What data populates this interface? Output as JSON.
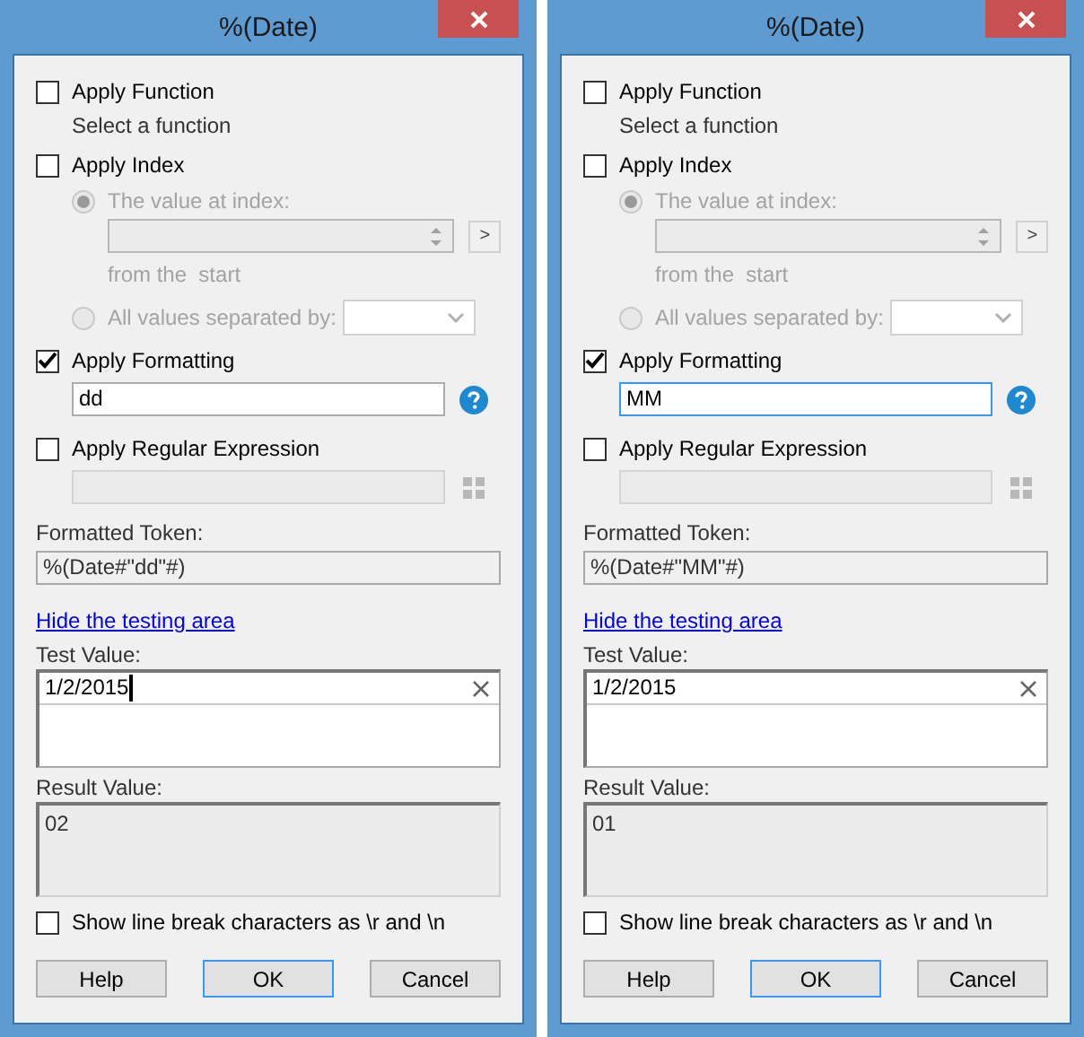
{
  "dialogs": [
    {
      "title": "%(Date)",
      "apply_function": {
        "label": "Apply Function",
        "checked": false,
        "hint": "Select a function"
      },
      "apply_index": {
        "label": "Apply Index",
        "checked": false,
        "options": [
          {
            "label": "The value at index:",
            "selected": true
          },
          {
            "label": "All values separated by:",
            "selected": false
          }
        ],
        "from_label": "from the  start",
        "next_button": ">"
      },
      "apply_formatting": {
        "label": "Apply Formatting",
        "checked": true,
        "value": "dd",
        "focused": false
      },
      "apply_regex": {
        "label": "Apply Regular Expression",
        "checked": false
      },
      "formatted_token": {
        "label": "Formatted Token:",
        "value": "%(Date#\"dd\"#)"
      },
      "link": "Hide the testing area",
      "test_value": {
        "label": "Test Value:",
        "value": "1/2/2015",
        "focused": true
      },
      "result_value": {
        "label": "Result Value:",
        "value": "02"
      },
      "show_line_breaks": {
        "label": "Show line break characters as \\r and \\n",
        "checked": false
      },
      "buttons": [
        {
          "label": "Help",
          "default": false
        },
        {
          "label": "OK",
          "default": true
        },
        {
          "label": "Cancel",
          "default": false
        }
      ]
    },
    {
      "title": "%(Date)",
      "apply_function": {
        "label": "Apply Function",
        "checked": false,
        "hint": "Select a function"
      },
      "apply_index": {
        "label": "Apply Index",
        "checked": false,
        "options": [
          {
            "label": "The value at index:",
            "selected": true
          },
          {
            "label": "All values separated by:",
            "selected": false
          }
        ],
        "from_label": "from the  start",
        "next_button": ">"
      },
      "apply_formatting": {
        "label": "Apply Formatting",
        "checked": true,
        "value": "MM",
        "focused": true
      },
      "apply_regex": {
        "label": "Apply Regular Expression",
        "checked": false
      },
      "formatted_token": {
        "label": "Formatted Token:",
        "value": "%(Date#\"MM\"#)"
      },
      "link": "Hide the testing area",
      "test_value": {
        "label": "Test Value:",
        "value": "1/2/2015",
        "focused": false
      },
      "result_value": {
        "label": "Result Value:",
        "value": "01"
      },
      "show_line_breaks": {
        "label": "Show line break characters as \\r and \\n",
        "checked": false
      },
      "buttons": [
        {
          "label": "Help",
          "default": false
        },
        {
          "label": "OK",
          "default": true
        },
        {
          "label": "Cancel",
          "default": false
        }
      ]
    }
  ]
}
